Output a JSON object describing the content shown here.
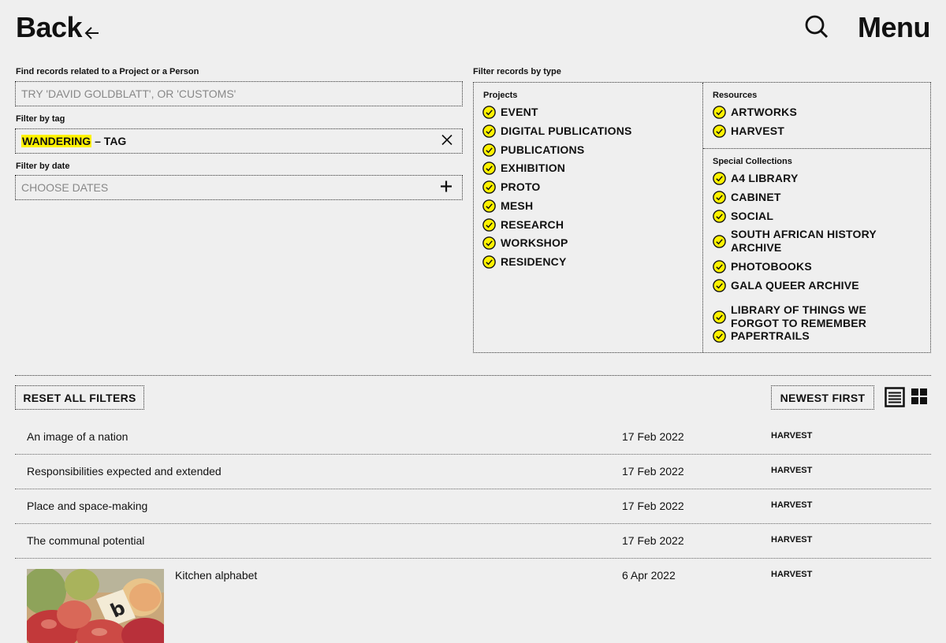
{
  "header": {
    "back_label": "Back",
    "menu_label": "Menu"
  },
  "filters": {
    "related_label": "Find records related to a Project or a Person",
    "related_placeholder": "TRY 'DAVID GOLDBLATT', OR 'CUSTOMS'",
    "tag_label": "Filter by tag",
    "tag_value": "WANDERING",
    "tag_suffix": "– TAG",
    "date_label": "Filter by date",
    "date_placeholder": "CHOOSE DATES"
  },
  "types": {
    "label": "Filter records by type",
    "projects": {
      "heading": "Projects",
      "items": [
        "EVENT",
        "DIGITAL PUBLICATIONS",
        "PUBLICATIONS",
        "EXHIBITION",
        "PROTO",
        "MESH",
        "RESEARCH",
        "WORKSHOP",
        "RESIDENCY"
      ]
    },
    "resources": {
      "heading": "Resources",
      "items": [
        "ARTWORKS",
        "HARVEST"
      ]
    },
    "special": {
      "heading": "Special Collections",
      "items": [
        "A4 LIBRARY",
        "CABINET",
        "SOCIAL",
        "SOUTH AFRICAN HISTORY ARCHIVE",
        "PHOTOBOOKS",
        "GALA QUEER ARCHIVE",
        "LIBRARY OF THINGS WE FORGOT TO REMEMBER",
        "PAPERTRAILS"
      ]
    }
  },
  "controls": {
    "reset_label": "RESET ALL FILTERS",
    "sort_label": "NEWEST FIRST"
  },
  "records": [
    {
      "title": "An image of a nation",
      "date": "17 Feb 2022",
      "type": "HARVEST"
    },
    {
      "title": "Responsibilities expected and extended",
      "date": "17 Feb 2022",
      "type": "HARVEST"
    },
    {
      "title": "Place and space-making",
      "date": "17 Feb 2022",
      "type": "HARVEST"
    },
    {
      "title": "The communal potential",
      "date": "17 Feb 2022",
      "type": "HARVEST"
    },
    {
      "title": "Kitchen alphabet",
      "date": "6 Apr 2022",
      "type": "HARVEST"
    }
  ],
  "colors": {
    "background": "#efefef",
    "highlight": "#fff200",
    "check_fill": "#fff200",
    "text": "#111111"
  },
  "icons": {
    "back": "arrow-left-icon",
    "search": "search-icon",
    "clear": "close-icon",
    "add": "plus-icon",
    "check": "check-circle-icon",
    "list_view": "list-view-icon",
    "grid_view": "grid-view-icon"
  }
}
